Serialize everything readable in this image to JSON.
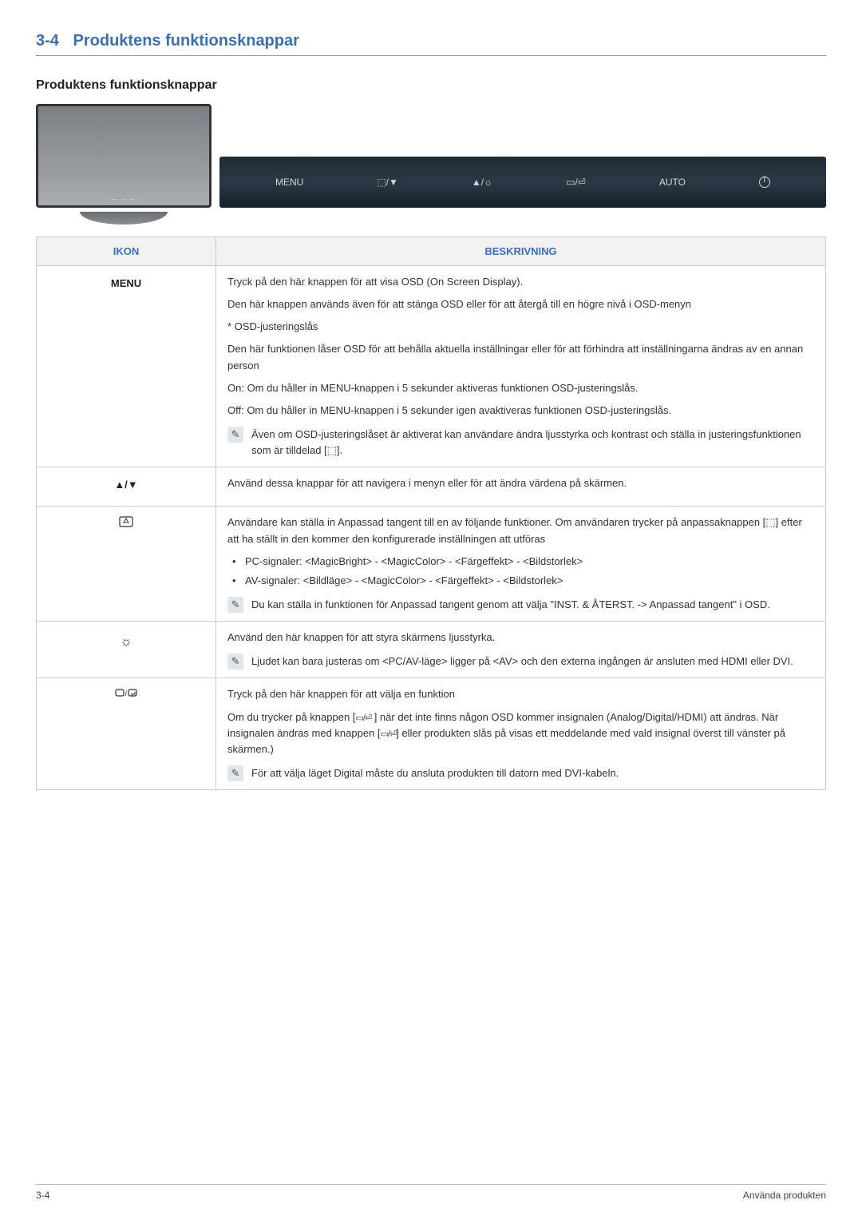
{
  "section": {
    "number": "3-4",
    "title": "Produktens funktionsknappar"
  },
  "subhead": "Produktens funktionsknappar",
  "panel_buttons": {
    "menu": "MENU",
    "custom_down": "⬚/▼",
    "up_bright": "▲/☼",
    "source_enter": "▭/⏎",
    "auto": "AUTO"
  },
  "table": {
    "headers": {
      "ikon": "IKON",
      "beskrivning": "BESKRIVNING"
    },
    "rows": {
      "menu": {
        "label": "MENU",
        "p1": "Tryck på den här knappen för att visa OSD (On Screen Display).",
        "p2": "Den här knappen används även för att stänga OSD eller för att återgå till en högre nivå i OSD-menyn",
        "p3": "* OSD-justeringslås",
        "p4": "Den här funktionen låser OSD för att behålla aktuella inställningar eller för att förhindra att inställningarna ändras av en annan person",
        "p5": "On: Om du håller in MENU-knappen i 5 sekunder aktiveras funktionen OSD-justeringslås.",
        "p6": "Off: Om du håller in MENU-knappen i 5 sekunder igen avaktiveras funktionen OSD-justeringslås.",
        "note": "Även om OSD-justeringslåset är aktiverat kan användare ändra ljusstyrka och kontrast och ställa in justeringsfunktionen som är tilldelad [⬚]."
      },
      "updown": {
        "label": "▲/▼",
        "p1": "Använd dessa knappar för att navigera i menyn eller för att ändra värdena på skärmen."
      },
      "custom": {
        "p1": "Användare kan ställa in Anpassad tangent till en av följande funktioner. Om användaren trycker på anpassaknappen [⬚] efter att ha ställt in den kommer den konfigurerade inställningen att utföras",
        "li1": "PC-signaler: <MagicBright> - <MagicColor> - <Färgeffekt> - <Bildstorlek>",
        "li2": "AV-signaler: <Bildläge> - <MagicColor> - <Färgeffekt> - <Bildstorlek>",
        "note": "Du kan ställa in funktionen för Anpassad tangent genom att välja \"INST. & ÅTERST. -> Anpassad tangent\" i OSD."
      },
      "brightness": {
        "p1": "Använd den här knappen för att styra skärmens ljusstyrka.",
        "note": "Ljudet kan bara justeras om <PC/AV-läge> ligger på <AV> och den externa ingången är ansluten med HDMI eller DVI."
      },
      "source": {
        "p1": "Tryck på den här knappen för att välja en funktion",
        "p2a": "Om du trycker på knappen [",
        "p2b": " ] när det inte finns någon OSD kommer insignalen (Analog/Digital/HDMI) att ändras. När insignalen ändras med knappen [",
        "p2c": "] eller produkten slås på visas ett meddelande med vald insignal överst till vänster på skärmen.)",
        "note": "För att välja läget Digital måste du ansluta produkten till datorn med DVI-kabeln."
      }
    }
  },
  "footer": {
    "left": "3-4",
    "right": "Använda produkten"
  },
  "icons": {
    "custom_key": "⬚",
    "source_key": "▭/⏎"
  }
}
